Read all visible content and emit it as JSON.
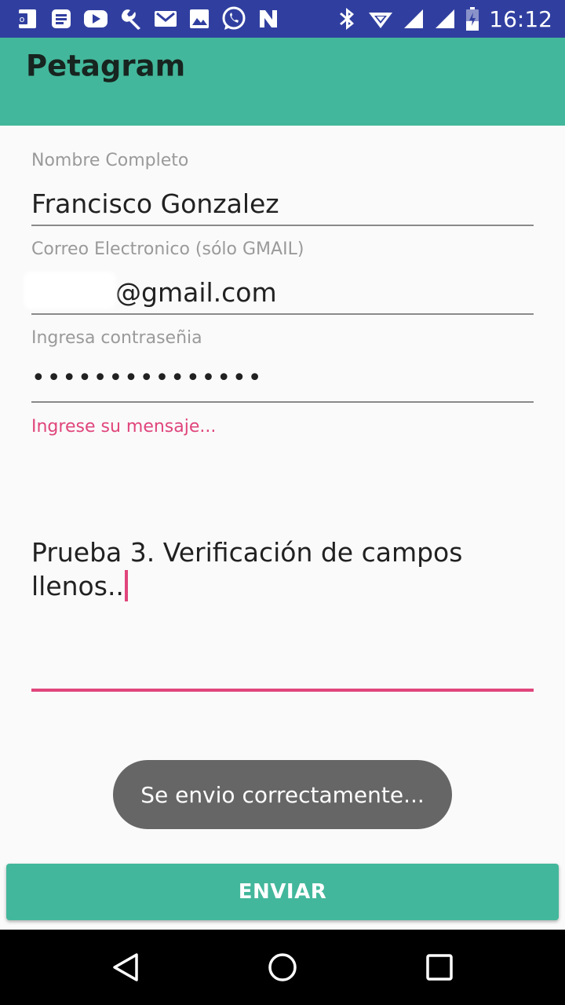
{
  "status_bar": {
    "time": "16:12",
    "left_icons": [
      "outlook-icon",
      "notes-icon",
      "youtube-icon",
      "wrench-icon",
      "gmail-icon",
      "photo-icon",
      "whatsapp-icon",
      "n-app-icon"
    ],
    "right_icons": [
      "bluetooth-icon",
      "wifi-icon",
      "signal-icon",
      "signal-icon-2",
      "battery-icon"
    ]
  },
  "app_bar": {
    "title": "Petagram"
  },
  "form": {
    "name": {
      "label": "Nombre Completo",
      "value": "Francisco Gonzalez"
    },
    "email": {
      "label": "Correo Electronico (sólo GMAIL)",
      "value": "@gmail.com"
    },
    "password": {
      "label": "Ingresa contraseñia",
      "value": "•••••••••••••••"
    },
    "message": {
      "label": "Ingrese su mensaje...",
      "value": "Prueba 3. Verificación de campos llenos.."
    }
  },
  "toast": {
    "text": "Se envio correctamente..."
  },
  "button": {
    "label": "ENVIAR"
  },
  "colors": {
    "primary": "#43b79b",
    "status_bar": "#303f9f",
    "accent": "#e0457b",
    "toast": "#666666"
  }
}
